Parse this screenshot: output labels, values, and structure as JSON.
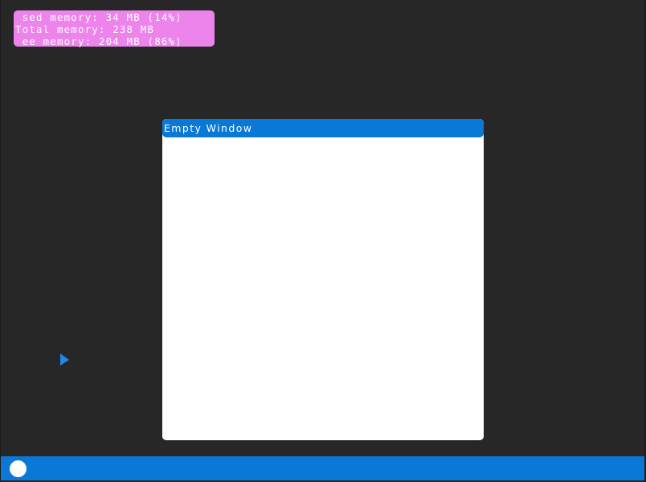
{
  "memory_widget": {
    "used_line": " sed memory: 34 MB (14%)",
    "total_line": "Total memory: 238 MB",
    "free_line": " ee memory: 204 MB (86%)"
  },
  "window": {
    "title": "Empty Window"
  },
  "colors": {
    "desktop": "#272727",
    "memory_widget": "#ec84ec",
    "accent": "#0a78d7",
    "window_body": "#ffffff",
    "cursor": "#1e88e5"
  },
  "icons": {
    "cursor": "arrow-cursor-icon",
    "start": "start-button-circle"
  }
}
